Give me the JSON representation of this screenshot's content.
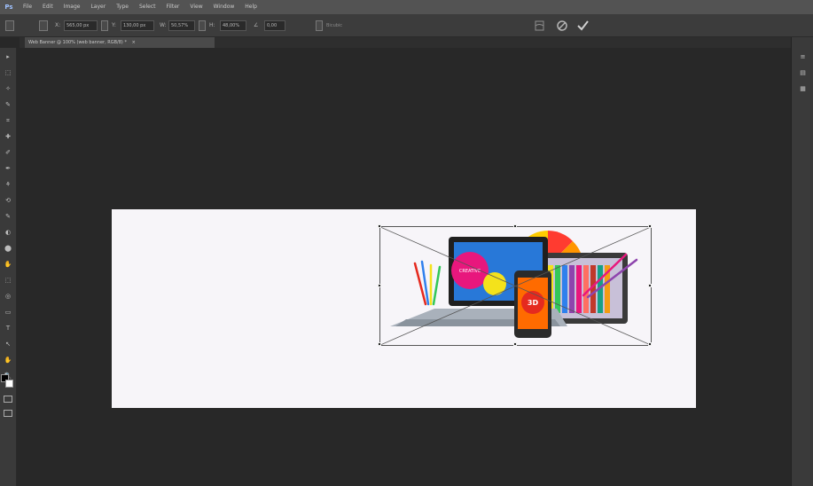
{
  "menubar": {
    "logo": "Ps",
    "items": [
      "File",
      "Edit",
      "Image",
      "Layer",
      "Type",
      "Select",
      "Filter",
      "View",
      "Window",
      "Help"
    ]
  },
  "options": {
    "x_value": "565,00 px",
    "y_value": "130,00 px",
    "width_value": "50,57%",
    "height_value": "48,00%",
    "angle_value": "0,00",
    "h_label": "H:",
    "interp_text": "Bicubic"
  },
  "document_tab": {
    "label": "Web Banner @ 100% (web banner, RGB/8) *",
    "close": "×"
  },
  "tools": [
    "▸",
    "⬚",
    "✧",
    "✎",
    "⌗",
    "✚",
    "✐",
    "✒",
    "⚘",
    "⟲",
    "✎",
    "◐",
    "⬤",
    "✋",
    "⬚",
    "◎",
    "▭",
    "T",
    "↖",
    "✋",
    "🔍"
  ],
  "right_panel": [
    "≡",
    "▤",
    "▦"
  ],
  "colors": {
    "menubar": "#535353",
    "workspace": "#282828",
    "canvas": "#f7f5f9",
    "accent_pink": "#e8177d",
    "accent_yellow": "#f4e21b",
    "accent_red": "#e52a1f"
  },
  "artwork": {
    "laptop_badge_text": "CREATIVE",
    "phone_badge_text": "3D"
  }
}
